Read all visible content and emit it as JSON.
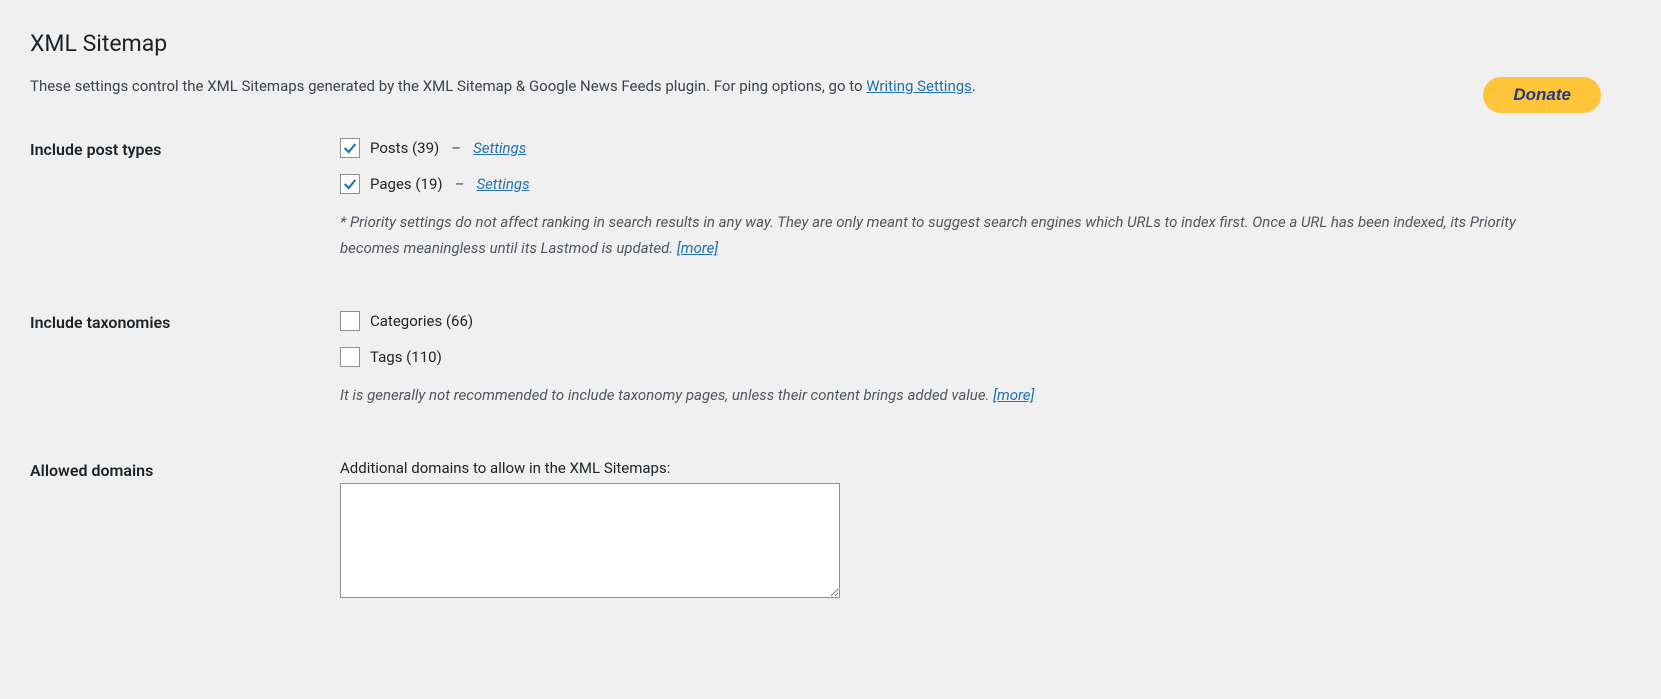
{
  "header": {
    "title": "XML Sitemap",
    "intro_prefix": "These settings control the XML Sitemaps generated by the XML Sitemap & Google News Feeds plugin. For ping options, go to ",
    "intro_link": "Writing Settings",
    "intro_suffix": ".",
    "donate_label": "Donate"
  },
  "post_types": {
    "section_label": "Include post types",
    "posts_label": "Posts (39)",
    "pages_label": "Pages (19)",
    "separator": "–",
    "settings_link": "Settings",
    "note_text": "* Priority settings do not affect ranking in search results in any way. They are only meant to suggest search engines which URLs to index first. Once a URL has been indexed, its Priority becomes meaningless until its Lastmod is updated. ",
    "more_link": "[more]"
  },
  "taxonomies": {
    "section_label": "Include taxonomies",
    "categories_label": "Categories (66)",
    "tags_label": "Tags (110)",
    "note_text": "It is generally not recommended to include taxonomy pages, unless their content brings added value. ",
    "more_link": "[more]"
  },
  "domains": {
    "section_label": "Allowed domains",
    "field_label": "Additional domains to allow in the XML Sitemaps:",
    "value": ""
  }
}
